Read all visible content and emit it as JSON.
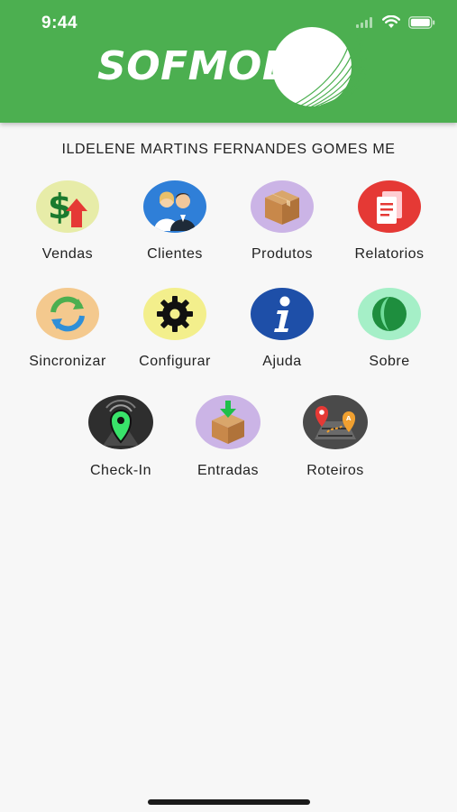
{
  "status_bar": {
    "time": "9:44"
  },
  "header": {
    "logo_text": "SOFMOB"
  },
  "company_name": "ILDELENE MARTINS FERNANDES GOMES ME",
  "menu": [
    {
      "label": "Vendas",
      "icon": "money-up-icon",
      "bg": "#e7eca8"
    },
    {
      "label": "Clientes",
      "icon": "people-icon",
      "bg": "#2f7fd8"
    },
    {
      "label": "Produtos",
      "icon": "box-icon",
      "bg": "#cbb4e6"
    },
    {
      "label": "Relatorios",
      "icon": "report-icon",
      "bg": "#e53935"
    },
    {
      "label": "Sincronizar",
      "icon": "sync-icon",
      "bg": "#f4c98e"
    },
    {
      "label": "Configurar",
      "icon": "gear-icon",
      "bg": "#f3ef8c"
    },
    {
      "label": "Ajuda",
      "icon": "info-icon",
      "bg": "#1e4fa8"
    },
    {
      "label": "Sobre",
      "icon": "leaf-icon",
      "bg": "#a5efc7"
    },
    {
      "label": "Check-In",
      "icon": "location-pin-icon",
      "bg": "#2e2e2e"
    },
    {
      "label": "Entradas",
      "icon": "box-download-icon",
      "bg": "#cbb4e6"
    },
    {
      "label": "Roteiros",
      "icon": "route-map-icon",
      "bg": "#4a4a4a"
    }
  ]
}
